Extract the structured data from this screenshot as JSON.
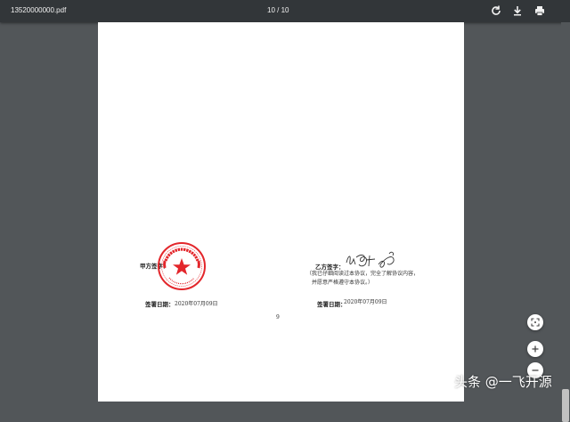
{
  "toolbar": {
    "filename": "13520000000.pdf",
    "page_indicator": "10 / 10"
  },
  "document": {
    "party_a_label": "甲方签字：",
    "party_a_date_label": "签署日期：",
    "party_a_date": "2020年07月09日",
    "party_b_label": "乙方签字：",
    "party_b_note_line1": "（我已仔细阅读过本协议，完全了解协议内容，",
    "party_b_note_line2": "并愿意严格遵守本协议。）",
    "party_b_date_label": "签署日期：",
    "party_b_date": "2020年07月09日",
    "page_number": "9"
  },
  "icons": {
    "rotate": "rotate-icon",
    "download": "download-icon",
    "print": "print-icon",
    "fit": "fit-page-icon",
    "zoom_in": "zoom-in-icon",
    "zoom_out": "zoom-out-icon"
  },
  "colors": {
    "toolbar_bg": "#323639",
    "viewer_bg": "#525659",
    "seal_red": "#e3262b"
  },
  "watermark": "头条 @一飞开源"
}
